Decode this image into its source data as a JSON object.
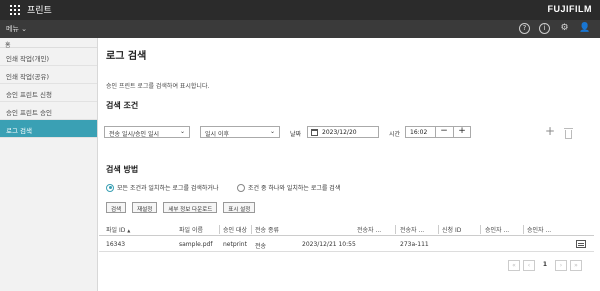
{
  "app": {
    "title": "프린트",
    "logo": "FUJIFILM"
  },
  "menubar": {
    "menu_label": "메뉴",
    "icons": [
      "help-icon",
      "info-icon",
      "gear-icon",
      "user-icon"
    ]
  },
  "sidebar": {
    "home": "홈",
    "items": [
      {
        "label": "인쇄 작업(개인)",
        "active": false
      },
      {
        "label": "인쇄 작업(공유)",
        "active": false
      },
      {
        "label": "승인 프린트 신청",
        "active": false
      },
      {
        "label": "승인 프린트 승인",
        "active": false
      },
      {
        "label": "로그 검색",
        "active": true
      }
    ]
  },
  "page": {
    "title": "로그 검색",
    "description": "승인 프린트 로그를 검색하여 표시합니다."
  },
  "conditions": {
    "heading": "검색 조건",
    "field": "전송 일시/승인 일시",
    "operator": "일시 이후",
    "date_label": "날짜",
    "date_value": "2023/12/20",
    "time_label": "시간",
    "time_value": "16:02"
  },
  "method": {
    "heading": "검색 방법",
    "option_all": "모든 조건과 일치하는 로그를 검색하거나",
    "option_any": "조건 중 하나와 일치하는 로그를 검색",
    "selected": "all"
  },
  "buttons": {
    "search": "검색",
    "reset": "재설정",
    "download": "세부 정보 다운로드",
    "display": "표시 설정"
  },
  "table": {
    "columns": [
      "파일 ID",
      "파일 이름",
      "승인 대상",
      "전송 종류",
      "전송자 ...",
      "전송자 ...",
      "신청 ID",
      "승인자 ...",
      "승인자 ..."
    ],
    "sort_indicator": "▲",
    "rows": [
      {
        "file_id": "16343",
        "file_name": "sample.pdf",
        "target": "netprint",
        "type": "전송",
        "sent_at": "2023/12/21 10:55",
        "sender": "273a-111",
        "request_id": "",
        "approver1": "",
        "approver2": ""
      }
    ]
  },
  "pager": {
    "current": "1"
  }
}
